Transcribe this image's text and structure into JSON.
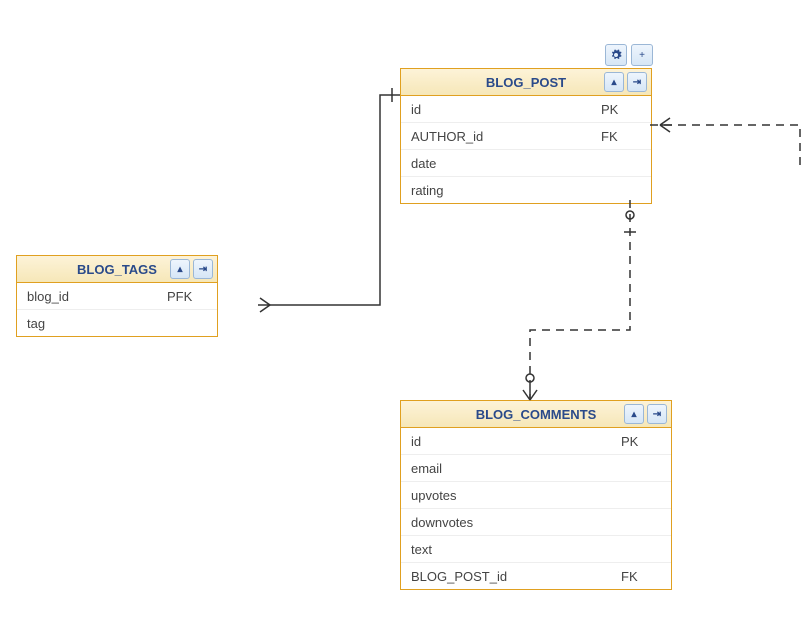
{
  "toolbar": {
    "gear_title": "Settings",
    "plus_title": "Add"
  },
  "entities": {
    "blog_post": {
      "title": "BLOG_POST",
      "collapse_title": "Collapse",
      "relate_title": "Relation",
      "rows": [
        {
          "name": "id",
          "key": "PK"
        },
        {
          "name": "AUTHOR_id",
          "key": "FK"
        },
        {
          "name": "date",
          "key": ""
        },
        {
          "name": "rating",
          "key": ""
        }
      ]
    },
    "blog_tags": {
      "title": "BLOG_TAGS",
      "collapse_title": "Collapse",
      "relate_title": "Relation",
      "rows": [
        {
          "name": "blog_id",
          "key": "PFK"
        },
        {
          "name": "tag",
          "key": ""
        }
      ]
    },
    "blog_comments": {
      "title": "BLOG_COMMENTS",
      "collapse_title": "Collapse",
      "relate_title": "Relation",
      "rows": [
        {
          "name": "id",
          "key": "PK"
        },
        {
          "name": "email",
          "key": ""
        },
        {
          "name": "upvotes",
          "key": ""
        },
        {
          "name": "downvotes",
          "key": ""
        },
        {
          "name": "text",
          "key": ""
        },
        {
          "name": "BLOG_POST_id",
          "key": "FK"
        }
      ]
    }
  }
}
